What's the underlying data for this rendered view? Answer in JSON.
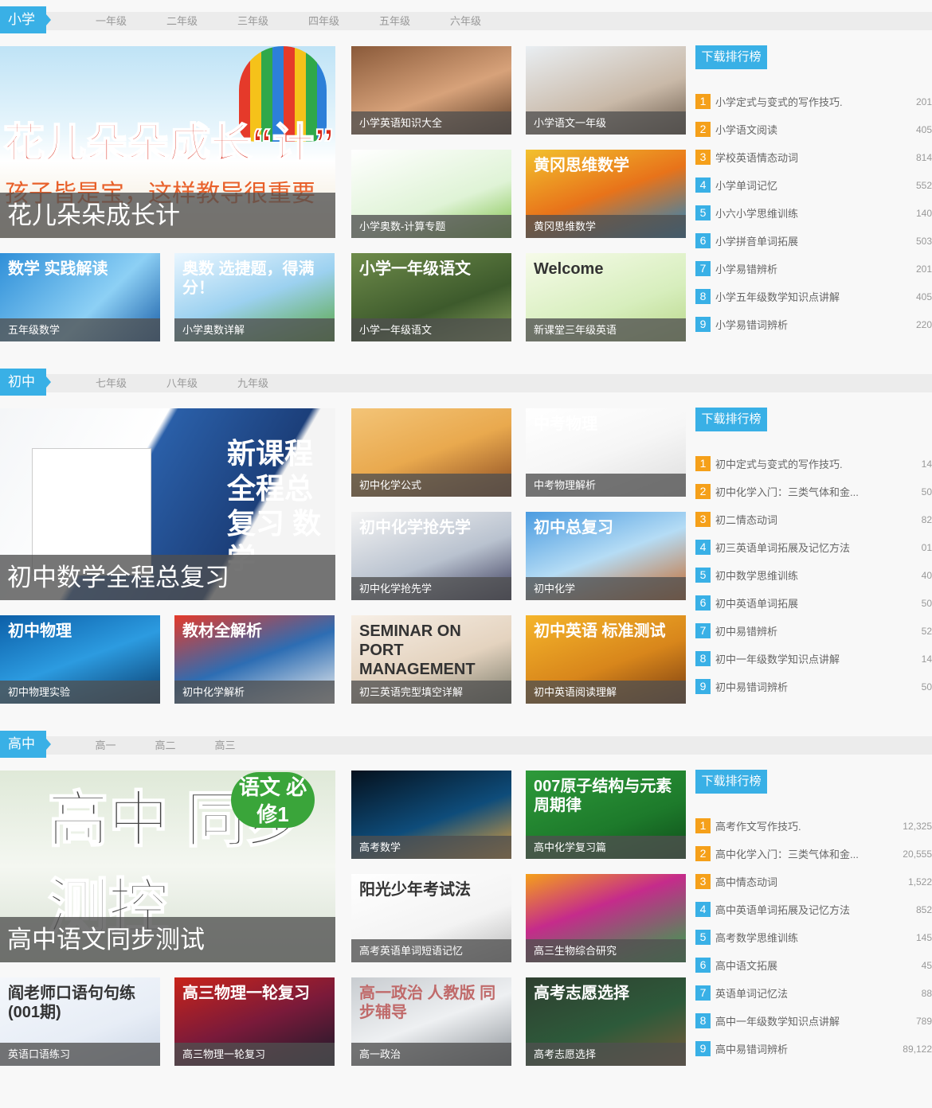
{
  "sections": [
    {
      "tag": "小学",
      "grades": [
        "一年级",
        "二年级",
        "三年级",
        "四年级",
        "五年级",
        "六年级"
      ],
      "big": {
        "caption": "花儿朵朵成长计",
        "art_text": "花儿朵朵成长“计”",
        "art_sub": "孩子皆是宝，这样教导很重要"
      },
      "tiles": [
        {
          "caption": "小学英语知识大全",
          "art": ""
        },
        {
          "caption": "小学语文一年级",
          "art": ""
        },
        {
          "caption": "小学奥数-计算专题",
          "art": ""
        },
        {
          "caption": "黄冈思维数学",
          "art": "黄冈思维数学"
        },
        {
          "caption": "五年级数学",
          "art": "数学 实践解读"
        },
        {
          "caption": "小学奥数详解",
          "art": "奥数 选捷题，得满分！"
        },
        {
          "caption": "小学一年级语文",
          "art": "小学一年级语文"
        },
        {
          "caption": "新课堂三年级英语",
          "art": "Welcome"
        }
      ],
      "rank_title": "下载排行榜",
      "rank": [
        {
          "n": "1",
          "name": "小学定式与变式的写作技巧.",
          "count": "201"
        },
        {
          "n": "2",
          "name": "小学语文阅读",
          "count": "405"
        },
        {
          "n": "3",
          "name": "学校英语情态动词",
          "count": "814"
        },
        {
          "n": "4",
          "name": "小学单词记忆",
          "count": "552"
        },
        {
          "n": "5",
          "name": "小六小学思维训练",
          "count": "140"
        },
        {
          "n": "6",
          "name": "小学拼音单词拓展",
          "count": "503"
        },
        {
          "n": "7",
          "name": "小学易错辨析",
          "count": "201"
        },
        {
          "n": "8",
          "name": "小学五年级数学知识点讲解",
          "count": "405"
        },
        {
          "n": "9",
          "name": "小学易错词辨析",
          "count": "220"
        }
      ]
    },
    {
      "tag": "初中",
      "grades": [
        "七年级",
        "八年级",
        "九年级"
      ],
      "big": {
        "caption": "初中数学全程总复习",
        "art_text": "新课程 全程总复习 数学",
        "art_sub": ""
      },
      "tiles": [
        {
          "caption": "初中化学公式",
          "art": ""
        },
        {
          "caption": "中考物理解析",
          "art": "中考物理"
        },
        {
          "caption": "初中化学抢先学",
          "art": "初中化学抢先学"
        },
        {
          "caption": "初中化学",
          "art": "初中总复习"
        },
        {
          "caption": "初中物理实验",
          "art": "初中物理"
        },
        {
          "caption": "初中化学解析",
          "art": "教材全解析"
        },
        {
          "caption": "初三英语完型填空详解",
          "art": "SEMINAR ON PORT MANAGEMENT"
        },
        {
          "caption": "初中英语阅读理解",
          "art": "初中英语 标准测试"
        }
      ],
      "rank_title": "下载排行榜",
      "rank": [
        {
          "n": "1",
          "name": "初中定式与变式的写作技巧.",
          "count": "14"
        },
        {
          "n": "2",
          "name": "初中化学入门：三类气体和金...",
          "count": "50"
        },
        {
          "n": "3",
          "name": "初二情态动词",
          "count": "82"
        },
        {
          "n": "4",
          "name": "初三英语单词拓展及记忆方法",
          "count": "01"
        },
        {
          "n": "5",
          "name": "初中数学思维训练",
          "count": "40"
        },
        {
          "n": "6",
          "name": "初中英语单词拓展",
          "count": "50"
        },
        {
          "n": "7",
          "name": "初中易错辨析",
          "count": "52"
        },
        {
          "n": "8",
          "name": "初中一年级数学知识点讲解",
          "count": "14"
        },
        {
          "n": "9",
          "name": "初中易错词辨析",
          "count": "50"
        }
      ]
    },
    {
      "tag": "高中",
      "grades": [
        "高一",
        "高二",
        "高三"
      ],
      "big": {
        "caption": "高中语文同步测试",
        "art_text": "高中 同步测控",
        "art_sub": "语文 必修1"
      },
      "tiles": [
        {
          "caption": "高考数学",
          "art": ""
        },
        {
          "caption": "高中化学复习篇",
          "art": "007原子结构与元素周期律"
        },
        {
          "caption": "高考英语单词短语记忆",
          "art": "阳光少年考试法"
        },
        {
          "caption": "高三生物综合研究",
          "art": ""
        },
        {
          "caption": "英语口语练习",
          "art": "阎老师口语句句练(001期)"
        },
        {
          "caption": "高三物理一轮复习",
          "art": "高三物理一轮复习"
        },
        {
          "caption": "高一政治",
          "art": "高一政治 人教版 同步辅导"
        },
        {
          "caption": "高考志愿选择",
          "art": "高考志愿选择"
        }
      ],
      "rank_title": "下载排行榜",
      "rank": [
        {
          "n": "1",
          "name": "高考作文写作技巧.",
          "count": "12,325"
        },
        {
          "n": "2",
          "name": "高中化学入门：三类气体和金...",
          "count": "20,555"
        },
        {
          "n": "3",
          "name": "高中情态动词",
          "count": "1,522"
        },
        {
          "n": "4",
          "name": "高中英语单词拓展及记忆方法",
          "count": "852"
        },
        {
          "n": "5",
          "name": "高考数学思维训练",
          "count": "145"
        },
        {
          "n": "6",
          "name": "高中语文拓展",
          "count": "45"
        },
        {
          "n": "7",
          "name": "英语单词记忆法",
          "count": "88"
        },
        {
          "n": "8",
          "name": "高中一年级数学知识点讲解",
          "count": "789"
        },
        {
          "n": "9",
          "name": "高中易错词辨析",
          "count": "89,122"
        }
      ]
    }
  ],
  "colors": {
    "accent": "#39b0e6",
    "rank_top": "#f5a01a"
  }
}
